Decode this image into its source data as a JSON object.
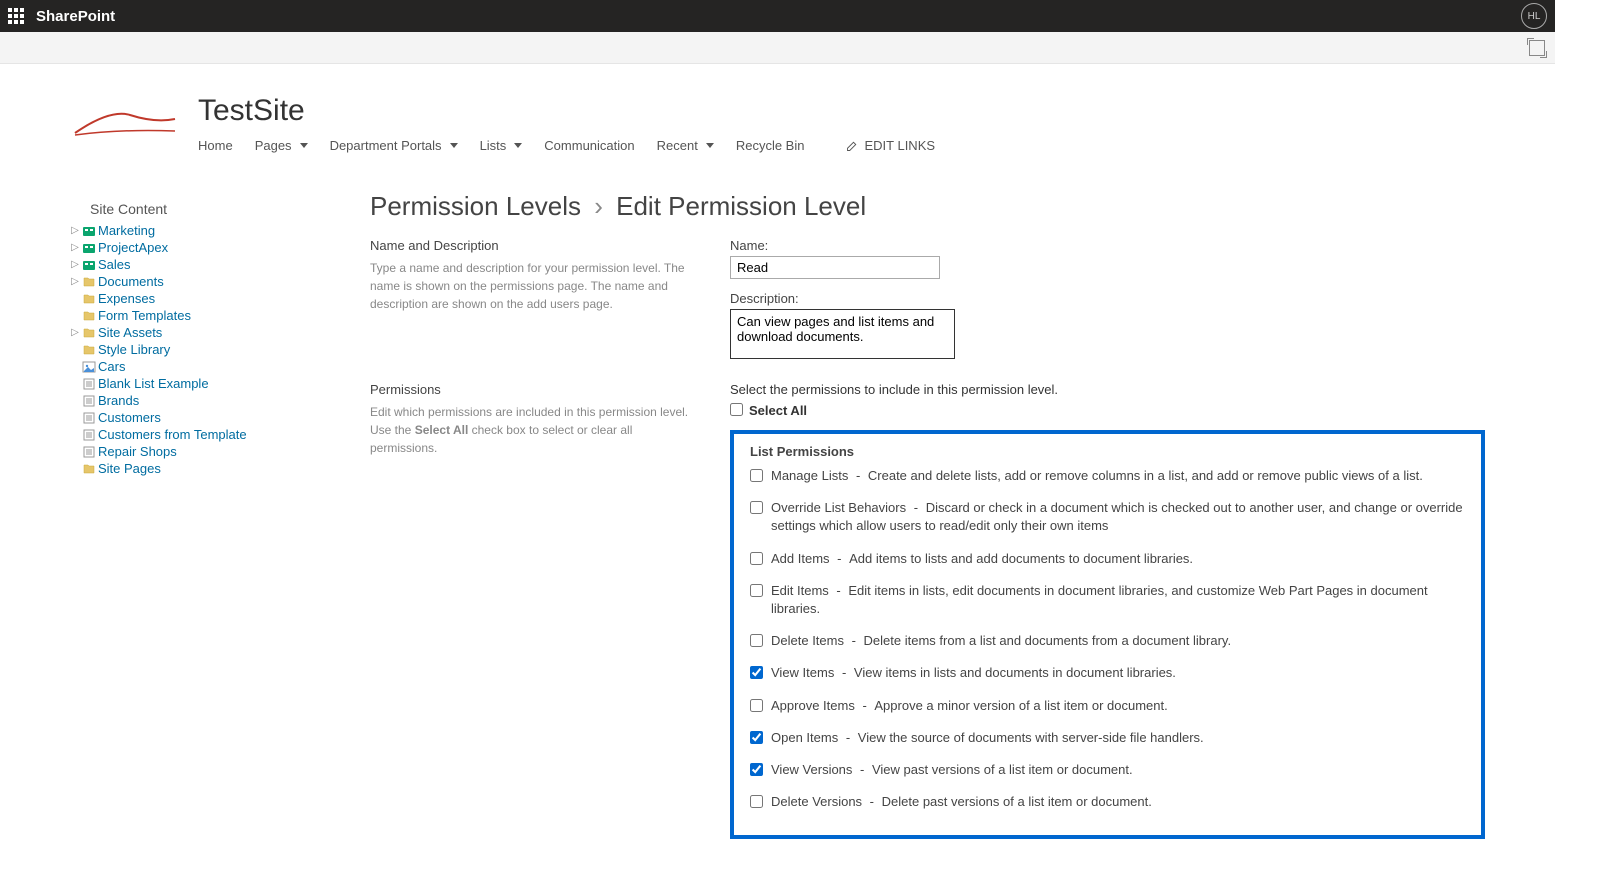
{
  "suite": {
    "product": "SharePoint",
    "user_initials": "HL"
  },
  "site": {
    "title": "TestSite",
    "nav": [
      {
        "label": "Home",
        "dropdown": false
      },
      {
        "label": "Pages",
        "dropdown": true
      },
      {
        "label": "Department Portals",
        "dropdown": true
      },
      {
        "label": "Lists",
        "dropdown": true
      },
      {
        "label": "Communication",
        "dropdown": false
      },
      {
        "label": "Recent",
        "dropdown": true
      },
      {
        "label": "Recycle Bin",
        "dropdown": false
      }
    ],
    "edit_links_label": "EDIT LINKS"
  },
  "leftnav": {
    "title": "Site Content",
    "items": [
      {
        "label": "Marketing",
        "icon": "subsite",
        "expandable": true
      },
      {
        "label": "ProjectApex",
        "icon": "subsite",
        "expandable": true
      },
      {
        "label": "Sales",
        "icon": "subsite",
        "expandable": true
      },
      {
        "label": "Documents",
        "icon": "library",
        "expandable": true
      },
      {
        "label": "Expenses",
        "icon": "library",
        "expandable": false
      },
      {
        "label": "Form Templates",
        "icon": "library",
        "expandable": false
      },
      {
        "label": "Site Assets",
        "icon": "library",
        "expandable": true
      },
      {
        "label": "Style Library",
        "icon": "library",
        "expandable": false
      },
      {
        "label": "Cars",
        "icon": "image-list",
        "expandable": false
      },
      {
        "label": "Blank List Example",
        "icon": "list",
        "expandable": false
      },
      {
        "label": "Brands",
        "icon": "list",
        "expandable": false
      },
      {
        "label": "Customers",
        "icon": "list",
        "expandable": false
      },
      {
        "label": "Customers from Template",
        "icon": "list",
        "expandable": false
      },
      {
        "label": "Repair Shops",
        "icon": "list",
        "expandable": false
      },
      {
        "label": "Site Pages",
        "icon": "library",
        "expandable": false
      }
    ]
  },
  "breadcrumb": {
    "parent": "Permission Levels",
    "current": "Edit Permission Level"
  },
  "section_name_desc": {
    "title": "Name and Description",
    "help": "Type a name and description for your permission level.  The name is shown on the permissions page.  The name and description are shown on the add users page.",
    "name_label": "Name:",
    "name_value": "Read",
    "desc_label": "Description:",
    "desc_value": "Can view pages and list items and download documents."
  },
  "section_permissions": {
    "title": "Permissions",
    "help_prefix": "Edit which permissions are included in this permission level. Use the ",
    "help_bold": "Select All",
    "help_suffix": " check box to select or clear all permissions.",
    "instruction": "Select the permissions to include in this permission level.",
    "select_all_label": "Select All"
  },
  "list_permissions": {
    "heading": "List Permissions",
    "items": [
      {
        "name": "Manage Lists",
        "desc": "Create and delete lists, add or remove columns in a list, and add or remove public views of a list.",
        "checked": false
      },
      {
        "name": "Override List Behaviors",
        "desc": "Discard or check in a document which is checked out to another user, and change or override settings which allow users to read/edit only their own items",
        "checked": false
      },
      {
        "name": "Add Items",
        "desc": "Add items to lists and add documents to document libraries.",
        "checked": false
      },
      {
        "name": "Edit Items",
        "desc": "Edit items in lists, edit documents in document libraries, and customize Web Part Pages in document libraries.",
        "checked": false
      },
      {
        "name": "Delete Items",
        "desc": "Delete items from a list and documents from a document library.",
        "checked": false
      },
      {
        "name": "View Items",
        "desc": "View items in lists and documents in document libraries.",
        "checked": true
      },
      {
        "name": "Approve Items",
        "desc": "Approve a minor version of a list item or document.",
        "checked": false
      },
      {
        "name": "Open Items",
        "desc": "View the source of documents with server-side file handlers.",
        "checked": true
      },
      {
        "name": "View Versions",
        "desc": "View past versions of a list item or document.",
        "checked": true
      },
      {
        "name": "Delete Versions",
        "desc": "Delete past versions of a list item or document.",
        "checked": false
      }
    ]
  }
}
